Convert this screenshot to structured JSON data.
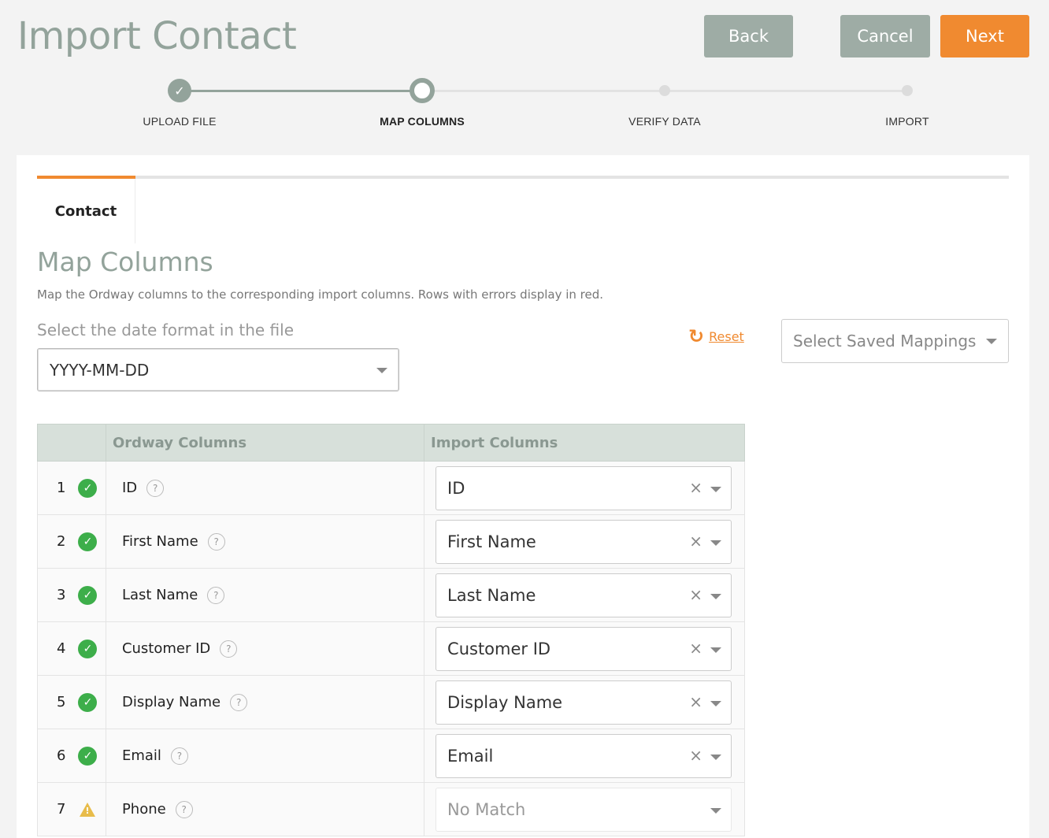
{
  "header": {
    "title": "Import Contact",
    "back_label": "Back",
    "cancel_label": "Cancel",
    "next_label": "Next"
  },
  "stepper": {
    "steps": [
      {
        "label": "UPLOAD FILE",
        "state": "done"
      },
      {
        "label": "MAP COLUMNS",
        "state": "current"
      },
      {
        "label": "VERIFY DATA",
        "state": "todo"
      },
      {
        "label": "IMPORT",
        "state": "todo"
      }
    ],
    "done_icon": "✓"
  },
  "tabs": [
    {
      "label": "Contact",
      "active": true
    }
  ],
  "section": {
    "title": "Map Columns",
    "description": "Map the Ordway columns to the corresponding import columns. Rows with errors display in red."
  },
  "date_format": {
    "label": "Select the date format in the file",
    "value": "YYYY-MM-DD"
  },
  "reset": {
    "label": "Reset",
    "icon": "↻"
  },
  "saved_mappings": {
    "placeholder": "Select Saved Mappings"
  },
  "table": {
    "headers": [
      "",
      "Ordway Columns",
      "Import Columns"
    ],
    "rows": [
      {
        "num": "1",
        "status": "ok",
        "ordway": "ID",
        "import": "ID"
      },
      {
        "num": "2",
        "status": "ok",
        "ordway": "First Name",
        "import": "First Name"
      },
      {
        "num": "3",
        "status": "ok",
        "ordway": "Last Name",
        "import": "Last Name"
      },
      {
        "num": "4",
        "status": "ok",
        "ordway": "Customer ID",
        "import": "Customer ID"
      },
      {
        "num": "5",
        "status": "ok",
        "ordway": "Display Name",
        "import": "Display Name"
      },
      {
        "num": "6",
        "status": "ok",
        "ordway": "Email",
        "import": "Email"
      },
      {
        "num": "7",
        "status": "warning",
        "ordway": "Phone",
        "import": "No Match"
      }
    ]
  },
  "glyphs": {
    "check": "✓",
    "help": "?",
    "clear": "×",
    "warn": "!"
  },
  "colors": {
    "accent": "#f08a30",
    "muted_green": "#93a39b",
    "ok": "#3dae4a",
    "warning": "#e8bc4a"
  }
}
